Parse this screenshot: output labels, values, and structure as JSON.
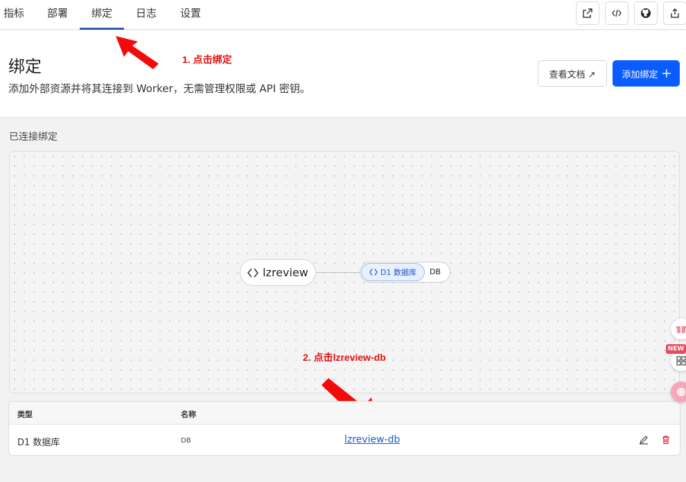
{
  "tabs": [
    {
      "label": "指标"
    },
    {
      "label": "部署"
    },
    {
      "label": "绑定",
      "active": true
    },
    {
      "label": "日志"
    },
    {
      "label": "设置"
    }
  ],
  "header": {
    "title": "绑定",
    "description": "添加外部资源并将其连接到 Worker，无需管理权限或 API 密钥。",
    "docs_button": "查看文档 ↗",
    "add_button": "添加绑定",
    "add_icon": "plus-icon"
  },
  "annotations": {
    "step1": "1. 点击绑定",
    "step2": "2. 点击lzreview-db"
  },
  "section": {
    "connected_label": "已连接绑定"
  },
  "graph": {
    "worker_name": "lzreview",
    "binding_type": "D1 数据库",
    "binding_name": "DB"
  },
  "table": {
    "headers": {
      "type": "类型",
      "name": "名称"
    },
    "rows": [
      {
        "type": "D1 数据库",
        "name": "DB",
        "resource": "lzreview-db"
      }
    ]
  },
  "widgets": {
    "new_badge": "NEW"
  },
  "colors": {
    "accent": "#0b5cff",
    "link": "#1f56c7",
    "annotation": "#e01010",
    "danger": "#d9283a"
  }
}
